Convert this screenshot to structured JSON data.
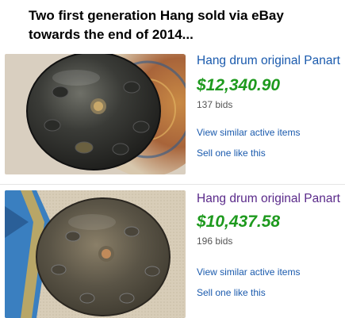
{
  "heading": "Two first generation Hang sold via eBay\ntowards the end of 2014...",
  "listings": [
    {
      "title": "Hang drum original Panart",
      "price": "$12,340.90",
      "bids": "137 bids",
      "similar_link": "View similar active items",
      "sell_link": "Sell one like this"
    },
    {
      "title": "Hang drum original Panart",
      "price": "$10,437.58",
      "bids": "196 bids",
      "similar_link": "View similar active items",
      "sell_link": "Sell one like this"
    }
  ],
  "colors": {
    "link": "#1a5aad",
    "visited_link": "#5a2a8a",
    "price": "#1e9a1e",
    "muted": "#555555"
  }
}
